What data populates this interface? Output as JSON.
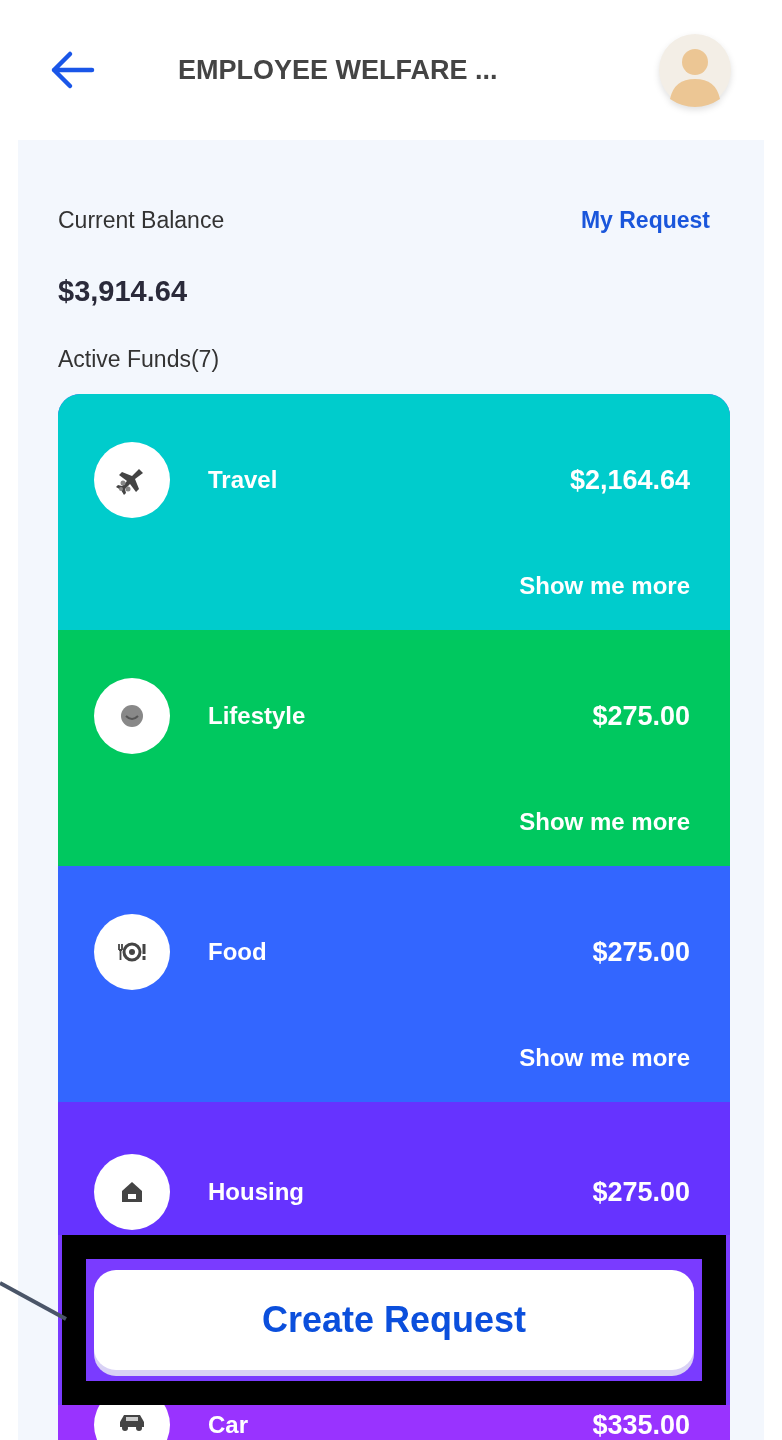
{
  "header": {
    "title": "EMPLOYEE WELFARE ..."
  },
  "balance": {
    "label": "Current Balance",
    "link": "My Request",
    "amount": "$3,914.64"
  },
  "funds_heading": "Active Funds(7)",
  "funds": [
    {
      "name": "Travel",
      "amount": "$2,164.64",
      "show_more": "Show me more",
      "color": "#00cccc"
    },
    {
      "name": "Lifestyle",
      "amount": "$275.00",
      "show_more": "Show me more",
      "color": "#00c85f"
    },
    {
      "name": "Food",
      "amount": "$275.00",
      "show_more": "Show me more",
      "color": "#3366ff"
    },
    {
      "name": "Housing",
      "amount": "$275.00",
      "color": "#6633ff"
    },
    {
      "name": "Car",
      "amount": "$335.00",
      "color": "#9933ff"
    }
  ],
  "action_button": "Create Request"
}
